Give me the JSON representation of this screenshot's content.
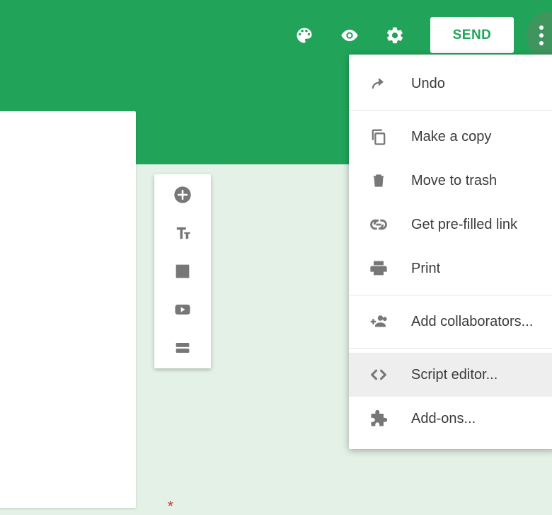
{
  "toolbar": {
    "send_label": "SEND"
  },
  "sidebox": {
    "items": [
      {
        "name": "add-question",
        "icon": "plus"
      },
      {
        "name": "add-title",
        "icon": "text"
      },
      {
        "name": "add-image",
        "icon": "image"
      },
      {
        "name": "add-video",
        "icon": "video"
      },
      {
        "name": "add-section",
        "icon": "section"
      }
    ]
  },
  "menu": {
    "groups": [
      [
        {
          "name": "undo",
          "icon": "undo",
          "label": "Undo"
        }
      ],
      [
        {
          "name": "make-copy",
          "icon": "copy",
          "label": "Make a copy"
        },
        {
          "name": "move-to-trash",
          "icon": "trash",
          "label": "Move to trash"
        },
        {
          "name": "prefilled-link",
          "icon": "link",
          "label": "Get pre-filled link"
        },
        {
          "name": "print",
          "icon": "print",
          "label": "Print"
        }
      ],
      [
        {
          "name": "add-collaborators",
          "icon": "people",
          "label": "Add collaborators..."
        }
      ],
      [
        {
          "name": "script-editor",
          "icon": "code",
          "label": "Script editor...",
          "hovered": true
        },
        {
          "name": "addons",
          "icon": "puzzle",
          "label": "Add-ons..."
        }
      ]
    ]
  },
  "required_marker": "*"
}
